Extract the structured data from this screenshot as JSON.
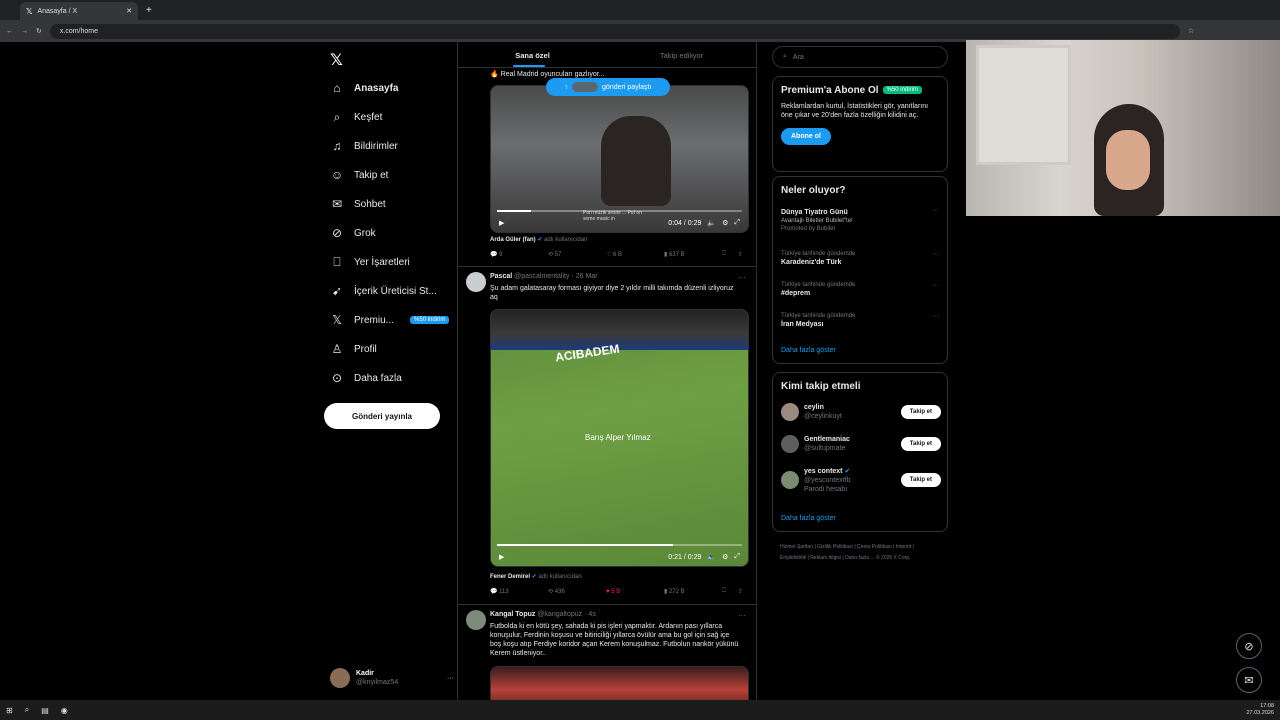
{
  "browser": {
    "tab_title": "Anasayfa / X",
    "url": "x.com/home"
  },
  "nav": {
    "items": [
      {
        "label": "Anasayfa",
        "icon": "home-icon"
      },
      {
        "label": "Keşfet",
        "icon": "search-icon"
      },
      {
        "label": "Bildirimler",
        "icon": "bell-icon"
      },
      {
        "label": "Takip et",
        "icon": "person-add-icon"
      },
      {
        "label": "Sohbet",
        "icon": "mail-icon"
      },
      {
        "label": "Grok",
        "icon": "grok-icon"
      },
      {
        "label": "Yer İşaretleri",
        "icon": "bookmark-icon"
      },
      {
        "label": "İçerik Üreticisi St...",
        "icon": "rocket-icon"
      },
      {
        "label": "Premiu...",
        "icon": "x-icon",
        "badge": "%50 indirim"
      },
      {
        "label": "Profil",
        "icon": "person-icon"
      },
      {
        "label": "Daha fazla",
        "icon": "more-circle-icon"
      }
    ],
    "post_button": "Gönderi yayınla",
    "user_name": "Kadir",
    "user_handle": "@knyilmaz54"
  },
  "feed": {
    "tabs": [
      "Sana özel",
      "Takip ediliyor"
    ],
    "new_posts_label": "gönderi paylaştı",
    "tweet1": {
      "text": "Real Madrid oyuncuları gazlıyor...",
      "video_time": "0:04 / 0:29",
      "video_progress": 0.14,
      "overlay_text": "Pon müzik sesini ... Put on some music in",
      "source_name": "Arda Güler (fan)",
      "source_suffix": "adlı kullanıcıdan",
      "replies": "9",
      "reposts": "57",
      "likes": "6 B",
      "views": "637 B"
    },
    "tweet2": {
      "name": "Pascal",
      "handle": "@pascalmentality",
      "date": "26 Mar",
      "text": "Şu adam galatasaray forması giyiyor diye 2 yıldır milli takımda düzenli izliyoruz aq",
      "board_text": "ACIBADEM",
      "player_caption": "Barış Alper Yılmaz",
      "video_time": "0:21 / 0:29",
      "video_progress": 0.72,
      "source_name": "Fener Demirel",
      "source_suffix": "adlı kullanıcıdan",
      "replies": "113",
      "reposts": "436",
      "likes": "5 B",
      "views": "272 B"
    },
    "tweet3": {
      "name": "Kangal Topuz",
      "handle": "@kangaltopuz",
      "date": "4s",
      "text": "Futbolda ki en kötü şey, sahada ki pis işleri yapmaktır. Ardanın pası yıllarca konuşulur, Ferdinin koşusu ve bitiriciliği yıllarca övülür ama bu gol için sağ içe boş koşu atıp Ferdiye koridor açan Kerem konuşulmaz. Futbolun nankör yükünü Kerem üstleniyor.."
    }
  },
  "sidebar": {
    "search_placeholder": "Ara",
    "premium": {
      "title": "Premium'a Abone Ol",
      "badge": "%50 indirim",
      "text": "Reklamlardan kurtul, İstatistikleri gör, yanıtlarını öne çıkar ve 20'den fazla özelliğin kilidini aç.",
      "button": "Abone ol"
    },
    "trends": {
      "title": "Neler oluyor?",
      "items": [
        {
          "context": "",
          "title": "Dünya Tiyatro Günü",
          "sub": "Avantajlı Biletler Bubilet\"te!",
          "extra": "Promoted by Bubilet"
        },
        {
          "context": "Türkiye tarihinde gündemde",
          "title": "Karadeniz'de Türk",
          "sub": "",
          "extra": ""
        },
        {
          "context": "Türkiye tarihinde gündemde",
          "title": "#deprem",
          "sub": "",
          "extra": ""
        },
        {
          "context": "Türkiye tarihinde gündemde",
          "title": "İran Medyası",
          "sub": "",
          "extra": ""
        }
      ],
      "show_more": "Daha fazla göster"
    },
    "who_to_follow": {
      "title": "Kimi takip etmeli",
      "items": [
        {
          "name": "ceylin",
          "handle": "@ceylinkuyt",
          "note": "",
          "button": "Takip et"
        },
        {
          "name": "Gentlemaniac",
          "handle": "@sultupmate",
          "note": "",
          "button": "Takip et"
        },
        {
          "name": "yes context",
          "handle": "@yescontextfb",
          "note": "Parodi hesabı",
          "button": "Takip et"
        }
      ],
      "show_more": "Daha fazla göster"
    },
    "footer": "Hizmet Şartları | Gizlilik Politikası | Çerez Politikası | Imprint | Erişilebilirlik | Reklam bilgisi | Daha fazla ... © 2026 X Corp."
  },
  "taskbar": {
    "time": "17:08",
    "date": "27.03.2026"
  },
  "colors": {
    "accent": "#1d9bf0",
    "like": "#f91880",
    "premium_badge": "#00ba7c"
  }
}
